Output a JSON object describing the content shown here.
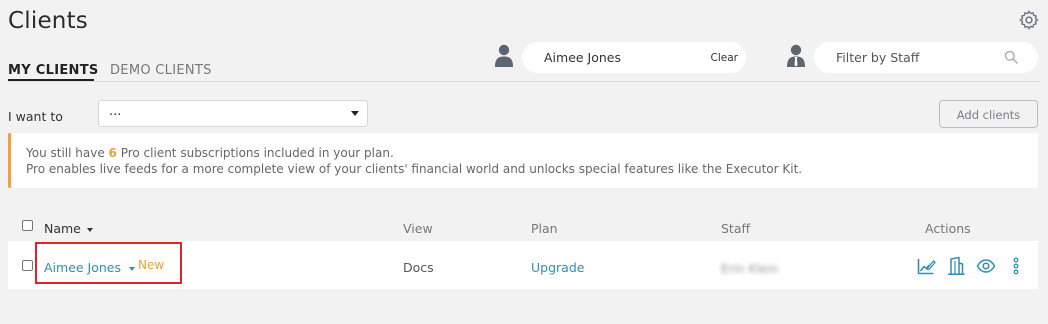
{
  "header": {
    "title": "Clients"
  },
  "tabs": [
    {
      "label": "MY CLIENTS",
      "active": true
    },
    {
      "label": "DEMO CLIENTS",
      "active": false
    }
  ],
  "client_filter": {
    "value": "Aimee Jones",
    "clear_label": "Clear"
  },
  "staff_filter": {
    "placeholder": "Filter by Staff"
  },
  "toolbar": {
    "i_want_to_label": "I want to",
    "action_select_value": "...",
    "add_clients_label": "Add clients"
  },
  "banner": {
    "line1_prefix": "You still have ",
    "line1_count": "6",
    "line1_suffix": " Pro client subscriptions included in your plan.",
    "line2": "Pro enables live feeds for a more complete view of your clients' financial world and unlocks special features like the Executor Kit."
  },
  "table": {
    "columns": {
      "name": "Name",
      "view": "View",
      "plan": "Plan",
      "staff": "Staff",
      "actions": "Actions"
    },
    "rows": [
      {
        "name": "Aimee Jones",
        "badge": "New",
        "view": "Docs",
        "plan": "Upgrade",
        "staff": "Erin Klein"
      }
    ]
  },
  "colors": {
    "accent": "#2f8fb7",
    "warning": "#f0a038",
    "highlight": "#e0222b"
  },
  "icons": [
    "settings-icon",
    "person-icon",
    "staff-person-icon",
    "search-icon",
    "edit-chart-icon",
    "building-icon",
    "eye-icon",
    "more-vertical-icon"
  ]
}
